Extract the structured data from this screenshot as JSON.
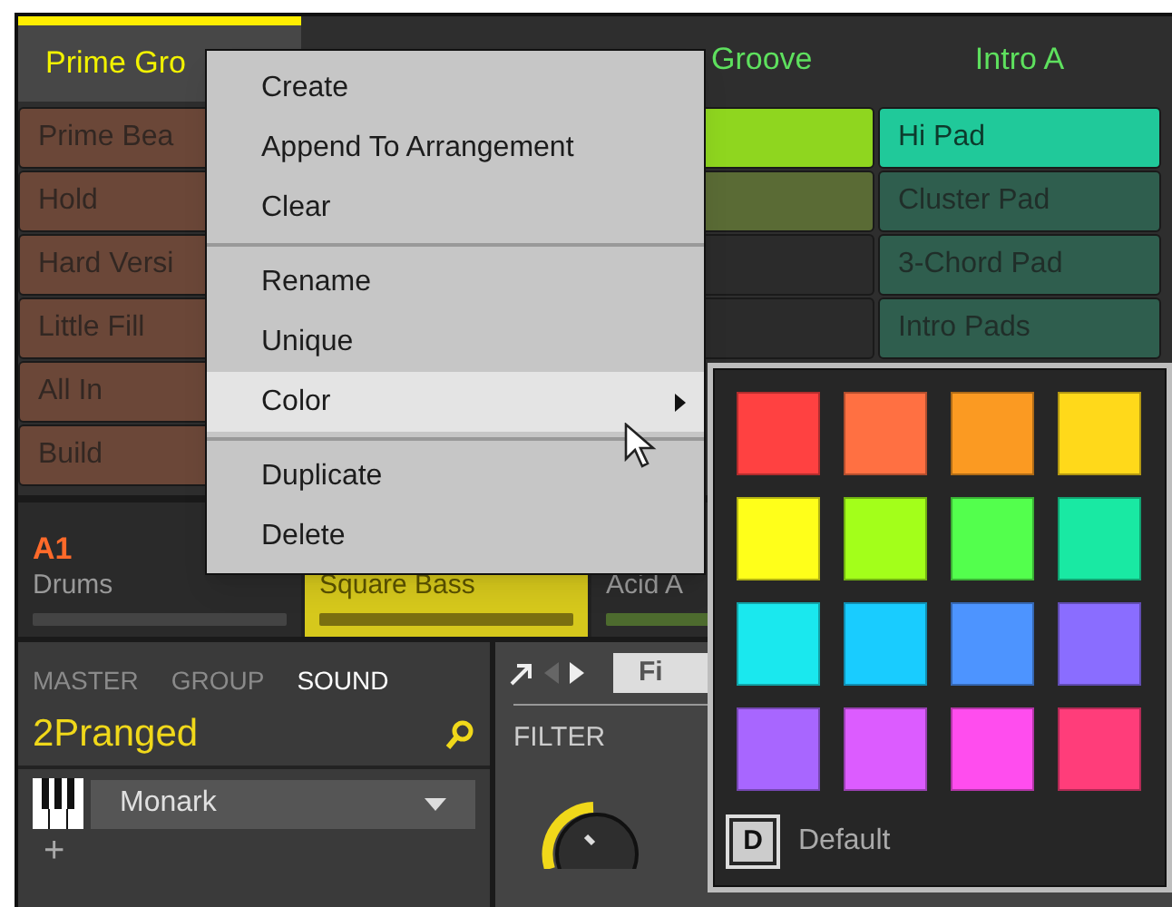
{
  "scenes": [
    {
      "label": "Prime Gro",
      "selected": true
    },
    {
      "label": "Groove",
      "selected": false
    },
    {
      "label": "Intro A",
      "selected": false
    }
  ],
  "pattern_columns": [
    {
      "cells": [
        {
          "label": "Prime Bea",
          "color": "#6b4738"
        },
        {
          "label": "Hold",
          "color": "#6b4738"
        },
        {
          "label": "Hard Versi",
          "color": "#6b4738"
        },
        {
          "label": "Little Fill",
          "color": "#6b4738"
        },
        {
          "label": "All In",
          "color": "#6b4738"
        },
        {
          "label": "Build",
          "color": "#6b4738"
        }
      ]
    },
    {},
    {
      "cells": [
        {
          "color": "#8fd61f"
        },
        {
          "color": "#5a6b35"
        },
        {
          "color": "#2b2b2b"
        },
        {
          "color": "#2b2b2b"
        }
      ]
    },
    {
      "cells": [
        {
          "label": "Hi Pad",
          "color": "#20c99a",
          "selected": true
        },
        {
          "label": "Cluster Pad",
          "color": "#2f5e4e",
          "selected": false
        },
        {
          "label": "3-Chord Pad",
          "color": "#2f5e4e",
          "selected": false
        },
        {
          "label": "Intro Pads",
          "color": "#2f5e4e",
          "selected": false
        }
      ]
    }
  ],
  "groups": [
    {
      "slot": "A1",
      "name": "Drums",
      "color": "#2a2a2a",
      "selected": false
    },
    {
      "name": "Square Bass",
      "color": "#d6c81c",
      "selected": true
    },
    {
      "name": "Acid A",
      "color": "#2a2a2a",
      "selected": false
    }
  ],
  "sound_panel": {
    "tabs": [
      {
        "label": "MASTER",
        "selected": false
      },
      {
        "label": "GROUP",
        "selected": false
      },
      {
        "label": "SOUND",
        "selected": true
      }
    ],
    "sound_name": "2Pranged",
    "plugin": "Monark",
    "add": "+"
  },
  "plugin_panel": {
    "page_button": "Fi",
    "section": "FILTER"
  },
  "context_menu": {
    "sections": [
      [
        {
          "label": "Create",
          "highlighted": false
        },
        {
          "label": "Append To Arrangement",
          "highlighted": false
        },
        {
          "label": "Clear",
          "highlighted": false
        }
      ],
      [
        {
          "label": "Rename",
          "highlighted": false
        },
        {
          "label": "Unique",
          "highlighted": false
        },
        {
          "label": "Color",
          "highlighted": true,
          "submenu": true
        }
      ],
      [
        {
          "label": "Duplicate",
          "highlighted": false
        },
        {
          "label": "Delete",
          "highlighted": false
        }
      ]
    ]
  },
  "color_palette": {
    "swatches": [
      {
        "color": "#ff4141"
      },
      {
        "color": "#ff7042"
      },
      {
        "color": "#fb9a22"
      },
      {
        "color": "#ffd91a"
      },
      {
        "color": "#ffff1a"
      },
      {
        "color": "#a3ff1a"
      },
      {
        "color": "#53ff4d"
      },
      {
        "color": "#19e9a3"
      },
      {
        "color": "#1ae8ee"
      },
      {
        "color": "#19ccff"
      },
      {
        "color": "#4d94ff"
      },
      {
        "color": "#8a6dff"
      },
      {
        "color": "#a866ff"
      },
      {
        "color": "#dc5cff"
      },
      {
        "color": "#ff4dee"
      },
      {
        "color": "#ff3d7a"
      }
    ],
    "default_key": "D",
    "default_label": "Default"
  }
}
